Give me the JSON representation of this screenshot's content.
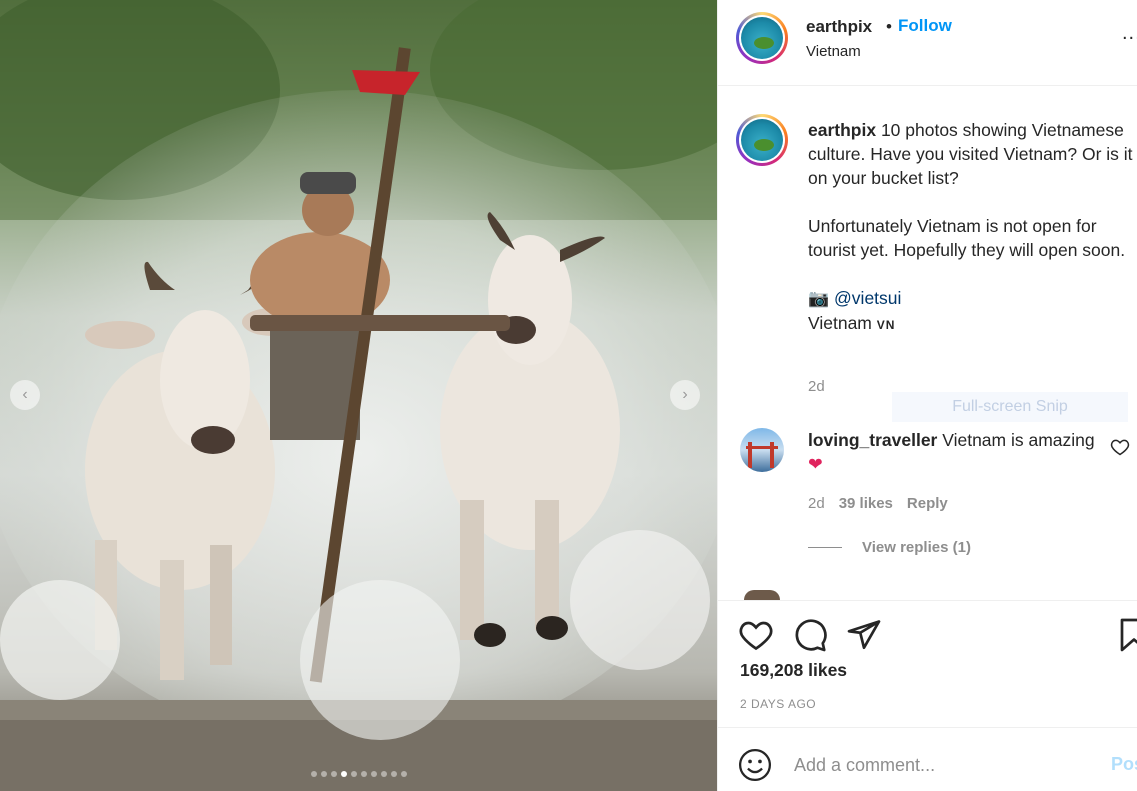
{
  "post": {
    "username": "earthpix",
    "bullet": "•",
    "follow_label": "Follow",
    "location": "Vietnam",
    "more_label": "...",
    "avatar_icon": "earth-globe-icon"
  },
  "caption": {
    "username": "earthpix",
    "text1": " 10 photos showing Vietnamese culture. Have you visited Vietnam? Or is it on your bucket list?",
    "text2": "Unfortunately Vietnam is not open for tourist yet. Hopefully they will open soon.",
    "camera_emoji": "📷",
    "mention": "@vietsui",
    "location_line": "Vietnam",
    "flag": "VN",
    "time": "2d"
  },
  "overlay": {
    "snip_label": "Full-screen Snip"
  },
  "comment": {
    "username": "loving_traveller",
    "text": " Vietnam is amazing ",
    "emoji": "❤",
    "time": "2d",
    "likes": "39 likes",
    "reply_label": "Reply",
    "view_replies": "View replies (1)"
  },
  "actions": {
    "likes": "169,208 likes",
    "ago": "2 DAYS AGO"
  },
  "composer": {
    "placeholder": "Add a comment...",
    "post_label": "Post"
  },
  "carousel": {
    "total": 10,
    "active_index": 3,
    "prev_label": "‹",
    "next_label": "›"
  },
  "colors": {
    "follow": "#0095f6",
    "muted": "#8e8e8e",
    "heart": "#e0245e"
  }
}
